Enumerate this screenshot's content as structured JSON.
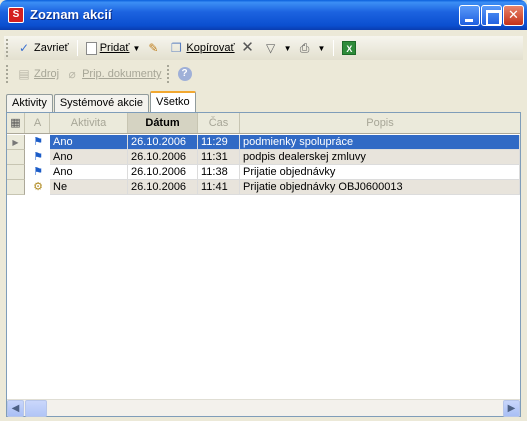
{
  "window": {
    "title": "Zoznam akcií",
    "app_icon": "S"
  },
  "toolbar1": {
    "close_label": "Zavrieť",
    "add_label": "Pridať",
    "copy_label": "Kopírovať"
  },
  "toolbar2": {
    "source_label": "Zdroj",
    "attachments_label": "Prip. dokumenty"
  },
  "tabs": [
    {
      "label": "Aktivity"
    },
    {
      "label": "Systémové akcie"
    },
    {
      "label": "Všetko"
    }
  ],
  "grid": {
    "columns": [
      "A",
      "Aktivita",
      "Dátum",
      "Čas",
      "Popis"
    ],
    "rows": [
      {
        "aktivita": "Ano",
        "datum": "26.10.2006",
        "cas": "11:29",
        "popis": "podmienky spolupráce"
      },
      {
        "aktivita": "Ano",
        "datum": "26.10.2006",
        "cas": "11:31",
        "popis": "podpis dealerskej zmluvy"
      },
      {
        "aktivita": "Ano",
        "datum": "26.10.2006",
        "cas": "11:38",
        "popis": "Prijatie objednávky"
      },
      {
        "aktivita": "Ne",
        "datum": "26.10.2006",
        "cas": "11:41",
        "popis": "Prijatie objednávky OBJ0600013"
      }
    ]
  },
  "colors": {
    "selection": "#316ac5",
    "titlebar": "#0b4fd0"
  }
}
